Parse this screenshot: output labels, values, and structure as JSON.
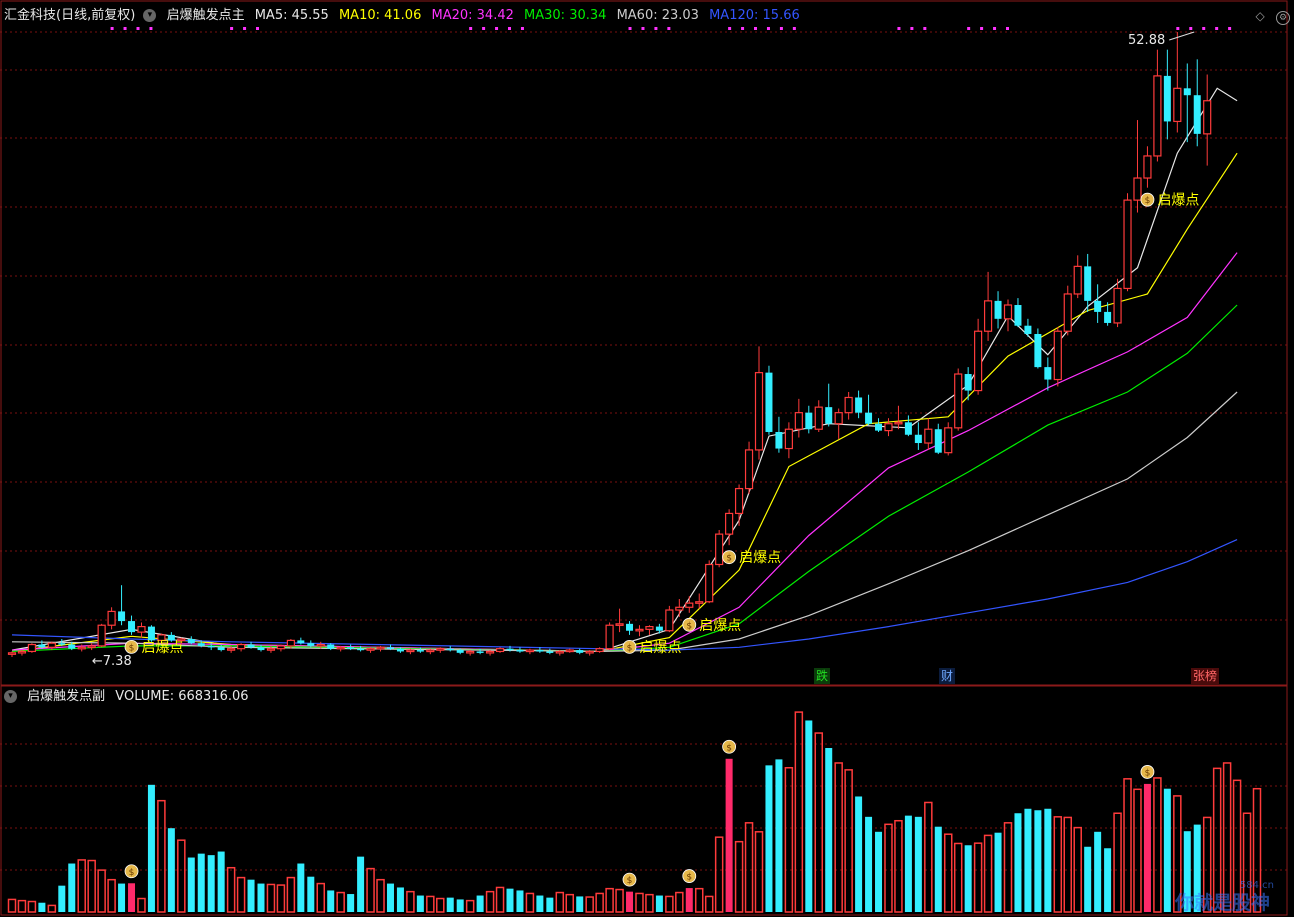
{
  "header": {
    "title": "汇金科技(日线,前复权)",
    "indicator_main": "启爆触发点主",
    "ma": [
      {
        "label": "MA5: 45.55",
        "color": "#e8e8e8"
      },
      {
        "label": "MA10: 41.06",
        "color": "#ffff00"
      },
      {
        "label": "MA20: 34.42",
        "color": "#ff33ff"
      },
      {
        "label": "MA30: 30.34",
        "color": "#00ee00"
      },
      {
        "label": "MA60: 23.03",
        "color": "#cccccc"
      },
      {
        "label": "MA120: 15.66",
        "color": "#3355ff"
      }
    ]
  },
  "sub_header": {
    "indicator_sub": "启爆触发点副",
    "volume_label": "VOLUME: 668316.06"
  },
  "annotations": {
    "high": "52.88",
    "low": "7.38",
    "signal": "启爆点"
  },
  "events": [
    {
      "label": "跌",
      "color": "#22dd22",
      "bg": "#0b3d0b"
    },
    {
      "label": "财",
      "color": "#6fa8ff",
      "bg": "#0b1c3d"
    },
    {
      "label": "张榜",
      "color": "#ff6666",
      "bg": "#4a0b0b"
    }
  ],
  "watermark": "你就是股神",
  "watermark_badge": "584.cn",
  "colors": {
    "up": "#ff3b3b",
    "down": "#33eeff",
    "signal_bar": "#ff2a6a",
    "grid": "#7a1010",
    "panel_border": "#8b1a1a"
  },
  "chart_data": {
    "type": "candlestick",
    "price_range": [
      7.38,
      52.88
    ],
    "candles": [
      [
        7.8,
        8.0,
        7.6,
        7.9
      ],
      [
        7.9,
        8.1,
        7.7,
        8.0
      ],
      [
        8.0,
        8.6,
        7.9,
        8.5
      ],
      [
        8.5,
        8.8,
        8.2,
        8.3
      ],
      [
        8.3,
        8.7,
        8.1,
        8.6
      ],
      [
        8.6,
        8.9,
        8.4,
        8.5
      ],
      [
        8.5,
        8.7,
        8.1,
        8.2
      ],
      [
        8.2,
        8.5,
        8.0,
        8.3
      ],
      [
        8.3,
        8.6,
        8.1,
        8.4
      ],
      [
        8.4,
        10.0,
        8.3,
        9.9
      ],
      [
        9.9,
        11.2,
        9.6,
        10.9
      ],
      [
        10.9,
        12.8,
        9.9,
        10.2
      ],
      [
        10.2,
        10.6,
        9.2,
        9.4
      ],
      [
        9.4,
        10.1,
        9.0,
        9.8
      ],
      [
        9.8,
        9.9,
        8.7,
        8.8
      ],
      [
        8.8,
        9.3,
        8.6,
        9.2
      ],
      [
        9.2,
        9.4,
        8.7,
        8.8
      ],
      [
        8.8,
        9.0,
        8.5,
        8.9
      ],
      [
        8.9,
        9.1,
        8.5,
        8.6
      ],
      [
        8.6,
        8.8,
        8.3,
        8.4
      ],
      [
        8.4,
        8.6,
        8.1,
        8.3
      ],
      [
        8.3,
        8.5,
        8.0,
        8.1
      ],
      [
        8.1,
        8.4,
        7.9,
        8.2
      ],
      [
        8.2,
        8.6,
        8.0,
        8.5
      ],
      [
        8.5,
        8.7,
        8.2,
        8.3
      ],
      [
        8.3,
        8.5,
        8.0,
        8.1
      ],
      [
        8.1,
        8.4,
        7.9,
        8.2
      ],
      [
        8.2,
        8.5,
        8.0,
        8.4
      ],
      [
        8.4,
        8.9,
        8.2,
        8.8
      ],
      [
        8.8,
        9.0,
        8.5,
        8.6
      ],
      [
        8.6,
        8.8,
        8.3,
        8.4
      ],
      [
        8.4,
        8.7,
        8.2,
        8.5
      ],
      [
        8.5,
        8.6,
        8.1,
        8.2
      ],
      [
        8.2,
        8.4,
        8.0,
        8.3
      ],
      [
        8.3,
        8.5,
        8.1,
        8.2
      ],
      [
        8.2,
        8.4,
        8.0,
        8.1
      ],
      [
        8.1,
        8.3,
        7.9,
        8.2
      ],
      [
        8.2,
        8.4,
        8.0,
        8.3
      ],
      [
        8.3,
        8.5,
        8.1,
        8.2
      ],
      [
        8.2,
        8.3,
        7.9,
        8.0
      ],
      [
        8.0,
        8.2,
        7.8,
        8.1
      ],
      [
        8.1,
        8.3,
        7.9,
        8.0
      ],
      [
        8.0,
        8.2,
        7.8,
        8.1
      ],
      [
        8.1,
        8.3,
        7.9,
        8.2
      ],
      [
        8.2,
        8.4,
        8.0,
        8.1
      ],
      [
        8.1,
        8.2,
        7.8,
        7.9
      ],
      [
        7.9,
        8.1,
        7.7,
        8.0
      ],
      [
        8.0,
        8.2,
        7.8,
        7.9
      ],
      [
        7.9,
        8.1,
        7.7,
        8.0
      ],
      [
        8.0,
        8.3,
        7.9,
        8.2
      ],
      [
        8.2,
        8.4,
        8.0,
        8.1
      ],
      [
        8.1,
        8.3,
        7.9,
        8.0
      ],
      [
        8.0,
        8.2,
        7.8,
        8.1
      ],
      [
        8.1,
        8.3,
        7.9,
        8.0
      ],
      [
        8.0,
        8.2,
        7.8,
        7.9
      ],
      [
        7.9,
        8.1,
        7.7,
        8.0
      ],
      [
        8.0,
        8.2,
        7.9,
        8.1
      ],
      [
        8.1,
        8.2,
        7.8,
        7.9
      ],
      [
        7.9,
        8.1,
        7.7,
        8.0
      ],
      [
        8.0,
        8.3,
        7.9,
        8.2
      ],
      [
        8.2,
        10.1,
        8.1,
        9.9
      ],
      [
        9.9,
        11.1,
        9.4,
        10.0
      ],
      [
        10.0,
        10.2,
        9.2,
        9.5
      ],
      [
        9.5,
        9.9,
        9.1,
        9.6
      ],
      [
        9.6,
        9.9,
        9.2,
        9.8
      ],
      [
        9.8,
        10.0,
        9.3,
        9.5
      ],
      [
        9.5,
        11.3,
        9.4,
        11.0
      ],
      [
        11.0,
        11.8,
        10.5,
        11.2
      ],
      [
        11.2,
        12.0,
        10.8,
        11.5
      ],
      [
        11.5,
        12.2,
        11.1,
        11.6
      ],
      [
        11.6,
        14.6,
        11.5,
        14.3
      ],
      [
        14.3,
        16.8,
        14.1,
        16.5
      ],
      [
        16.5,
        18.3,
        15.7,
        18.0
      ],
      [
        18.0,
        20.1,
        17.1,
        19.8
      ],
      [
        19.8,
        23.2,
        19.4,
        22.6
      ],
      [
        22.6,
        30.1,
        21.9,
        28.2
      ],
      [
        28.2,
        28.7,
        23.7,
        23.9
      ],
      [
        23.9,
        25.0,
        22.4,
        22.7
      ],
      [
        22.7,
        24.6,
        22.0,
        24.1
      ],
      [
        24.1,
        26.3,
        23.5,
        25.3
      ],
      [
        25.3,
        25.8,
        23.8,
        24.1
      ],
      [
        24.1,
        26.2,
        23.9,
        25.7
      ],
      [
        25.7,
        27.4,
        24.3,
        24.5
      ],
      [
        24.5,
        25.6,
        23.4,
        25.3
      ],
      [
        25.3,
        26.8,
        24.8,
        26.4
      ],
      [
        26.4,
        26.9,
        24.9,
        25.3
      ],
      [
        25.3,
        26.6,
        24.4,
        24.5
      ],
      [
        24.5,
        24.9,
        23.9,
        24.0
      ],
      [
        24.0,
        24.9,
        23.6,
        24.5
      ],
      [
        24.5,
        25.8,
        24.1,
        24.6
      ],
      [
        24.6,
        25.1,
        23.6,
        23.7
      ],
      [
        23.7,
        24.6,
        22.6,
        23.1
      ],
      [
        23.1,
        24.9,
        22.6,
        24.1
      ],
      [
        24.1,
        24.5,
        22.3,
        22.4
      ],
      [
        22.4,
        24.6,
        22.2,
        24.2
      ],
      [
        24.2,
        28.5,
        24.0,
        28.1
      ],
      [
        28.1,
        28.6,
        26.2,
        26.9
      ],
      [
        26.9,
        32.1,
        26.6,
        31.2
      ],
      [
        31.2,
        35.5,
        30.5,
        33.4
      ],
      [
        33.4,
        34.1,
        31.4,
        32.1
      ],
      [
        32.1,
        33.5,
        31.2,
        33.1
      ],
      [
        33.1,
        33.6,
        31.5,
        31.6
      ],
      [
        31.6,
        32.1,
        30.8,
        31.0
      ],
      [
        31.0,
        31.4,
        28.5,
        28.6
      ],
      [
        28.6,
        29.3,
        26.9,
        27.7
      ],
      [
        27.7,
        31.5,
        27.2,
        31.2
      ],
      [
        31.2,
        34.5,
        30.9,
        33.9
      ],
      [
        33.9,
        36.7,
        33.6,
        35.9
      ],
      [
        35.9,
        36.8,
        32.6,
        33.4
      ],
      [
        33.4,
        34.6,
        31.8,
        32.6
      ],
      [
        32.6,
        33.3,
        31.6,
        31.8
      ],
      [
        31.8,
        35.0,
        31.5,
        34.3
      ],
      [
        34.3,
        41.2,
        34.1,
        40.7
      ],
      [
        40.7,
        46.5,
        39.8,
        42.3
      ],
      [
        42.3,
        44.6,
        41.6,
        43.9
      ],
      [
        43.9,
        51.6,
        43.5,
        49.7
      ],
      [
        49.7,
        51.6,
        45.1,
        46.4
      ],
      [
        46.4,
        52.88,
        45.6,
        48.8
      ],
      [
        48.8,
        50.6,
        44.9,
        48.3
      ],
      [
        48.3,
        50.9,
        44.6,
        45.5
      ],
      [
        45.5,
        49.8,
        43.2,
        47.9
      ]
    ],
    "ma_lines": {
      "MA5": [
        [
          0,
          8.1
        ],
        [
          12,
          9.6
        ],
        [
          22,
          8.4
        ],
        [
          59,
          8.0
        ],
        [
          66,
          9.6
        ],
        [
          73,
          17.5
        ],
        [
          76,
          23.6
        ],
        [
          82,
          24.5
        ],
        [
          90,
          24.2
        ],
        [
          96,
          27.3
        ],
        [
          100,
          32.3
        ],
        [
          104,
          29.5
        ],
        [
          108,
          33.0
        ],
        [
          113,
          35.8
        ],
        [
          117,
          44.1
        ],
        [
          121,
          48.8
        ],
        [
          123,
          47.9
        ]
      ],
      "MA10": [
        [
          0,
          8.0
        ],
        [
          12,
          9.1
        ],
        [
          22,
          8.5
        ],
        [
          59,
          8.0
        ],
        [
          66,
          9.0
        ],
        [
          73,
          13.9
        ],
        [
          78,
          21.4
        ],
        [
          86,
          24.5
        ],
        [
          94,
          25.0
        ],
        [
          100,
          29.4
        ],
        [
          108,
          32.7
        ],
        [
          114,
          33.9
        ],
        [
          118,
          38.6
        ],
        [
          123,
          44.1
        ]
      ],
      "MA20": [
        [
          0,
          8.1
        ],
        [
          12,
          8.6
        ],
        [
          22,
          8.5
        ],
        [
          59,
          8.0
        ],
        [
          66,
          8.6
        ],
        [
          73,
          11.2
        ],
        [
          80,
          16.4
        ],
        [
          88,
          21.3
        ],
        [
          96,
          24.0
        ],
        [
          104,
          27.1
        ],
        [
          112,
          29.7
        ],
        [
          118,
          32.2
        ],
        [
          123,
          36.9
        ]
      ],
      "MA30": [
        [
          0,
          8.0
        ],
        [
          12,
          8.4
        ],
        [
          22,
          8.4
        ],
        [
          59,
          8.0
        ],
        [
          66,
          8.3
        ],
        [
          73,
          10.0
        ],
        [
          80,
          13.8
        ],
        [
          88,
          17.8
        ],
        [
          96,
          21.0
        ],
        [
          104,
          24.4
        ],
        [
          112,
          26.8
        ],
        [
          118,
          29.6
        ],
        [
          123,
          33.1
        ]
      ],
      "MA60": [
        [
          0,
          8.7
        ],
        [
          12,
          8.6
        ],
        [
          22,
          8.3
        ],
        [
          59,
          8.0
        ],
        [
          66,
          8.1
        ],
        [
          73,
          8.9
        ],
        [
          80,
          10.6
        ],
        [
          88,
          12.9
        ],
        [
          96,
          15.3
        ],
        [
          104,
          17.9
        ],
        [
          112,
          20.5
        ],
        [
          118,
          23.5
        ],
        [
          123,
          26.8
        ]
      ],
      "MA120": [
        [
          0,
          9.2
        ],
        [
          12,
          8.9
        ],
        [
          22,
          8.7
        ],
        [
          59,
          8.2
        ],
        [
          66,
          8.1
        ],
        [
          73,
          8.3
        ],
        [
          80,
          8.9
        ],
        [
          88,
          9.8
        ],
        [
          96,
          10.8
        ],
        [
          104,
          11.8
        ],
        [
          112,
          13.0
        ],
        [
          118,
          14.5
        ],
        [
          123,
          16.1
        ]
      ]
    },
    "signal_indices": [
      12,
      62,
      68,
      72,
      114
    ],
    "volume_range": [
      0,
      668316.06
    ],
    "volume": [
      42000,
      38000,
      35000,
      31000,
      22000,
      88000,
      162000,
      174000,
      172000,
      140000,
      108000,
      95000,
      96000,
      45000,
      425000,
      372000,
      280000,
      240000,
      182000,
      195000,
      190000,
      202000,
      148000,
      115000,
      108000,
      95000,
      92000,
      90000,
      115000,
      162000,
      118000,
      95000,
      72000,
      65000,
      60000,
      185000,
      145000,
      108000,
      95000,
      82000,
      68000,
      55000,
      52000,
      45000,
      48000,
      42000,
      38000,
      55000,
      68000,
      82000,
      78000,
      72000,
      62000,
      55000,
      48000,
      65000,
      58000,
      52000,
      50000,
      62000,
      78000,
      75000,
      68000,
      62000,
      58000,
      55000,
      52000,
      65000,
      80000,
      78000,
      52000,
      250000,
      512000,
      235000,
      298000,
      268000,
      490000,
      510000,
      482000,
      668000,
      640000,
      598000,
      548000,
      498000,
      475000,
      386000,
      318000,
      268000,
      293000,
      305000,
      322000,
      318000,
      366000,
      285000,
      260000,
      229000,
      223000,
      230000,
      256000,
      265000,
      298000,
      330000,
      345000,
      340000,
      345000,
      318000,
      316000,
      282000,
      218000,
      268000,
      213000,
      330000,
      445000,
      410000,
      428000,
      448000,
      412000,
      388000,
      270000,
      292000,
      316000,
      480000,
      498000,
      440000,
      330000,
      412000
    ]
  }
}
